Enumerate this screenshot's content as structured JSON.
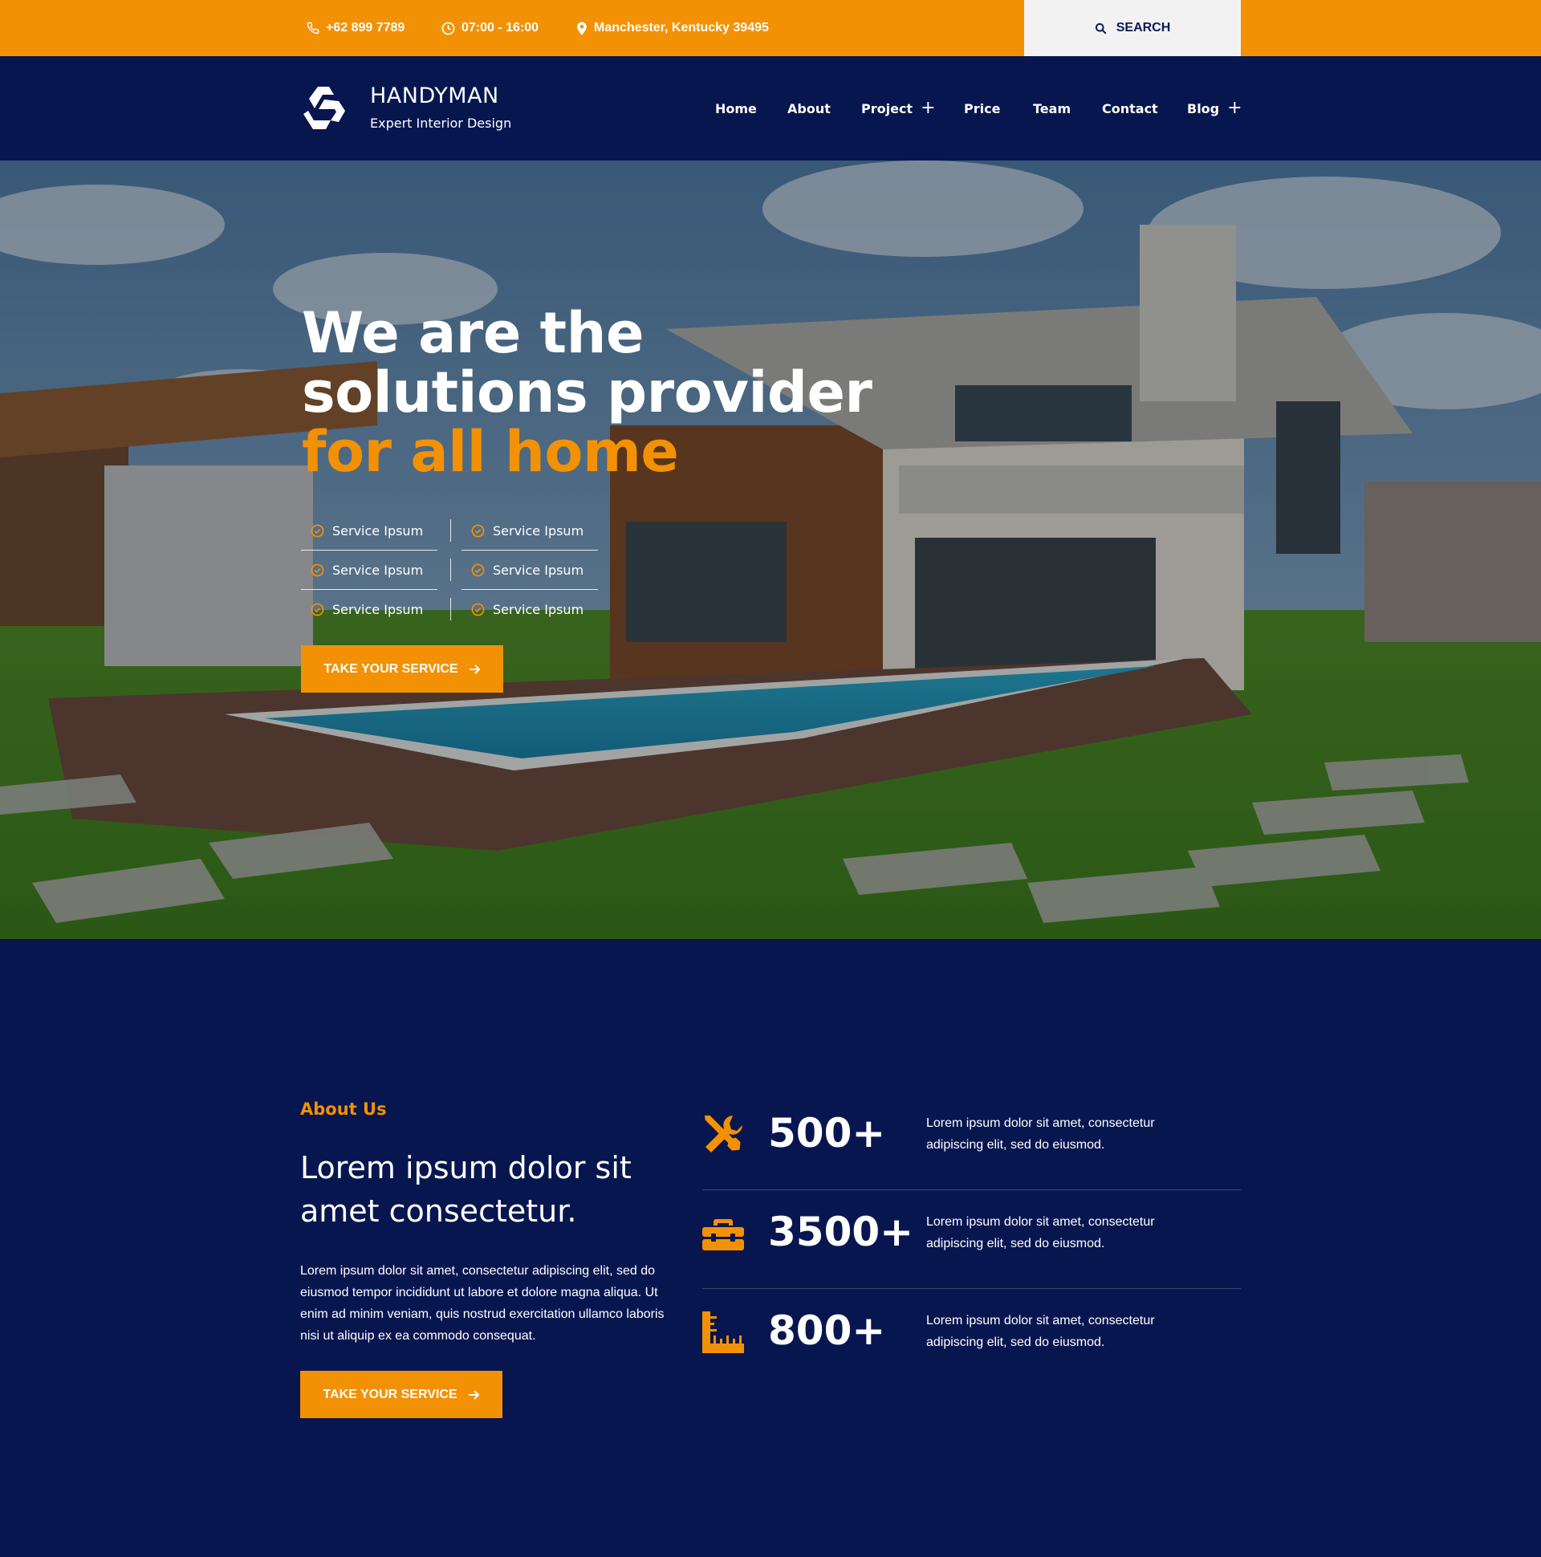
{
  "topbar": {
    "phone": "+62 899 7789",
    "hours": "07:00 - 16:00",
    "address": "Manchester, Kentucky 39495",
    "search_label": "SEARCH"
  },
  "brand": {
    "name": "HANDYMAN",
    "tagline": "Expert Interior Design"
  },
  "nav": {
    "items": [
      {
        "label": "Home"
      },
      {
        "label": "About"
      },
      {
        "label": "Project"
      },
      {
        "label": "Price"
      },
      {
        "label": "Team"
      },
      {
        "label": "Contact"
      },
      {
        "label": "Blog"
      }
    ]
  },
  "hero": {
    "title_line1": "We are the",
    "title_line2": "solutions provider",
    "title_accent": "for all home",
    "services": [
      "Service Ipsum",
      "Service Ipsum",
      "Service Ipsum",
      "Service Ipsum",
      "Service Ipsum",
      "Service Ipsum"
    ],
    "cta_label": "TAKE YOUR SERVICE"
  },
  "about": {
    "kicker": "About Us",
    "title": "Lorem ipsum dolor sit amet consectetur.",
    "text": "Lorem ipsum dolor sit amet, consectetur adipiscing elit, sed do eiusmod tempor incididunt ut labore et dolore magna aliqua. Ut enim ad minim veniam, quis nostrud exercitation ullamco laboris nisi ut aliquip ex ea commodo consequat.",
    "cta_label": "TAKE YOUR SERVICE",
    "stats": [
      {
        "icon": "tools-icon",
        "value": "500+",
        "desc": "Lorem ipsum dolor sit amet, consectetur adipiscing elit, sed do eiusmod."
      },
      {
        "icon": "toolbox-icon",
        "value": "3500+",
        "desc": "Lorem ipsum dolor sit amet, consectetur adipiscing elit, sed do eiusmod."
      },
      {
        "icon": "ruler-icon",
        "value": "800+",
        "desc": "Lorem ipsum dolor sit amet, consectetur adipiscing elit, sed do eiusmod."
      }
    ]
  },
  "colors": {
    "accent": "#f39104",
    "navy": "#081650",
    "search_bg": "#f2f2f3"
  }
}
